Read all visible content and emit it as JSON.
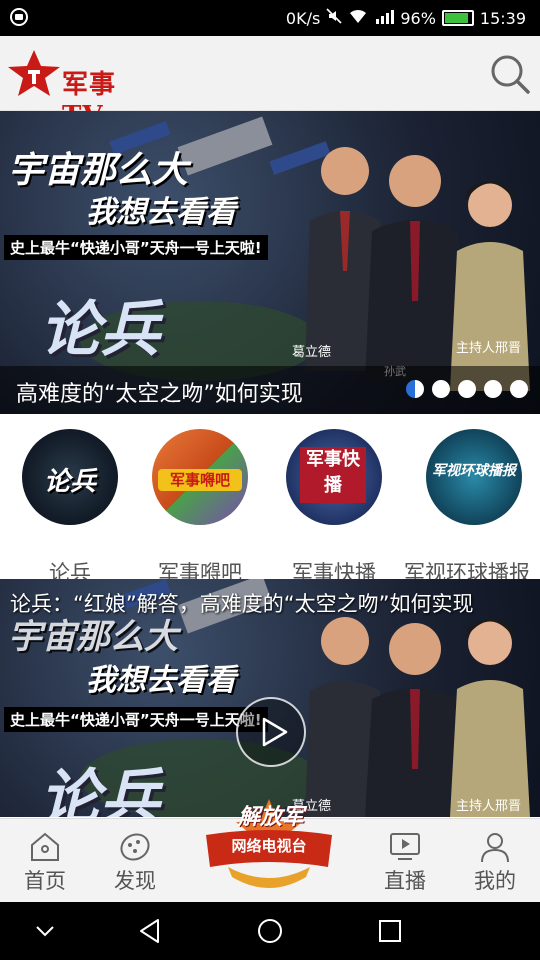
{
  "status_bar": {
    "network_speed": "0K/s",
    "battery_percent": "96%",
    "time": "15:39",
    "battery_level": 0.96,
    "icons": [
      "app-notification-icon",
      "mute-icon",
      "wifi-icon",
      "signal-4g-icon",
      "battery-icon"
    ]
  },
  "header": {
    "logo_text": "军事TV",
    "search_icon": "search-icon"
  },
  "banner": {
    "poster_line1": "宇宙那么大",
    "poster_line2": "我想去看看",
    "poster_line3": "史上最牛“快递小哥”天舟一号上天啦!",
    "poster_brand": "论兵",
    "person1_name": "葛立德",
    "person2_name": "孙武",
    "host_name": "主持人邢晋",
    "caption": "高难度的“太空之吻”如何实现",
    "page_count": 5,
    "active_page": 1
  },
  "channels": [
    {
      "label": "论兵",
      "badge": "论兵",
      "color": "#1a2a3a"
    },
    {
      "label": "军事嘚吧",
      "badge": "军事嘚吧",
      "color": "#e06a2a"
    },
    {
      "label": "军事快播",
      "badge": "军事快播",
      "color": "#b01a2a"
    },
    {
      "label": "军视环球播报",
      "badge": "军视环球播报",
      "color": "#1a6a8a"
    }
  ],
  "video": {
    "title": "论兵：“红娘”解答，高难度的“太空之吻”如何实现",
    "poster_line1": "宇宙那么大",
    "poster_line2": "我想去看看",
    "poster_line3": "史上最牛“快递小哥”天舟一号上天啦!",
    "poster_brand": "论兵",
    "person1_name": "葛立德",
    "host_name": "主持人邢晋"
  },
  "bottom_nav": {
    "home": "首页",
    "discover": "发现",
    "center_title": "解放军",
    "center_subtitle": "网络电视台",
    "live": "直播",
    "mine": "我的"
  },
  "colors": {
    "brand_red": "#c81a16",
    "active_dot": "#2a6fd8"
  }
}
